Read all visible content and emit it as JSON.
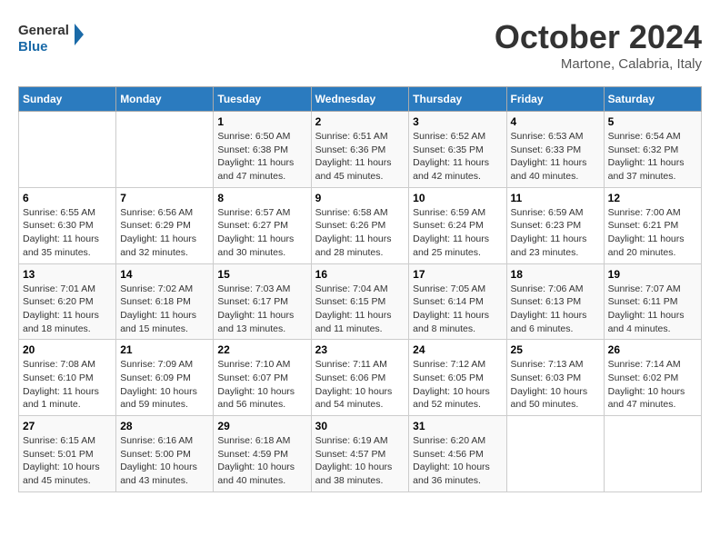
{
  "logo": {
    "line1": "General",
    "line2": "Blue"
  },
  "title": "October 2024",
  "subtitle": "Martone, Calabria, Italy",
  "header": {
    "days": [
      "Sunday",
      "Monday",
      "Tuesday",
      "Wednesday",
      "Thursday",
      "Friday",
      "Saturday"
    ]
  },
  "weeks": [
    [
      {
        "day": "",
        "info": ""
      },
      {
        "day": "",
        "info": ""
      },
      {
        "day": "1",
        "info": "Sunrise: 6:50 AM\nSunset: 6:38 PM\nDaylight: 11 hours and 47 minutes."
      },
      {
        "day": "2",
        "info": "Sunrise: 6:51 AM\nSunset: 6:36 PM\nDaylight: 11 hours and 45 minutes."
      },
      {
        "day": "3",
        "info": "Sunrise: 6:52 AM\nSunset: 6:35 PM\nDaylight: 11 hours and 42 minutes."
      },
      {
        "day": "4",
        "info": "Sunrise: 6:53 AM\nSunset: 6:33 PM\nDaylight: 11 hours and 40 minutes."
      },
      {
        "day": "5",
        "info": "Sunrise: 6:54 AM\nSunset: 6:32 PM\nDaylight: 11 hours and 37 minutes."
      }
    ],
    [
      {
        "day": "6",
        "info": "Sunrise: 6:55 AM\nSunset: 6:30 PM\nDaylight: 11 hours and 35 minutes."
      },
      {
        "day": "7",
        "info": "Sunrise: 6:56 AM\nSunset: 6:29 PM\nDaylight: 11 hours and 32 minutes."
      },
      {
        "day": "8",
        "info": "Sunrise: 6:57 AM\nSunset: 6:27 PM\nDaylight: 11 hours and 30 minutes."
      },
      {
        "day": "9",
        "info": "Sunrise: 6:58 AM\nSunset: 6:26 PM\nDaylight: 11 hours and 28 minutes."
      },
      {
        "day": "10",
        "info": "Sunrise: 6:59 AM\nSunset: 6:24 PM\nDaylight: 11 hours and 25 minutes."
      },
      {
        "day": "11",
        "info": "Sunrise: 6:59 AM\nSunset: 6:23 PM\nDaylight: 11 hours and 23 minutes."
      },
      {
        "day": "12",
        "info": "Sunrise: 7:00 AM\nSunset: 6:21 PM\nDaylight: 11 hours and 20 minutes."
      }
    ],
    [
      {
        "day": "13",
        "info": "Sunrise: 7:01 AM\nSunset: 6:20 PM\nDaylight: 11 hours and 18 minutes."
      },
      {
        "day": "14",
        "info": "Sunrise: 7:02 AM\nSunset: 6:18 PM\nDaylight: 11 hours and 15 minutes."
      },
      {
        "day": "15",
        "info": "Sunrise: 7:03 AM\nSunset: 6:17 PM\nDaylight: 11 hours and 13 minutes."
      },
      {
        "day": "16",
        "info": "Sunrise: 7:04 AM\nSunset: 6:15 PM\nDaylight: 11 hours and 11 minutes."
      },
      {
        "day": "17",
        "info": "Sunrise: 7:05 AM\nSunset: 6:14 PM\nDaylight: 11 hours and 8 minutes."
      },
      {
        "day": "18",
        "info": "Sunrise: 7:06 AM\nSunset: 6:13 PM\nDaylight: 11 hours and 6 minutes."
      },
      {
        "day": "19",
        "info": "Sunrise: 7:07 AM\nSunset: 6:11 PM\nDaylight: 11 hours and 4 minutes."
      }
    ],
    [
      {
        "day": "20",
        "info": "Sunrise: 7:08 AM\nSunset: 6:10 PM\nDaylight: 11 hours and 1 minute."
      },
      {
        "day": "21",
        "info": "Sunrise: 7:09 AM\nSunset: 6:09 PM\nDaylight: 10 hours and 59 minutes."
      },
      {
        "day": "22",
        "info": "Sunrise: 7:10 AM\nSunset: 6:07 PM\nDaylight: 10 hours and 56 minutes."
      },
      {
        "day": "23",
        "info": "Sunrise: 7:11 AM\nSunset: 6:06 PM\nDaylight: 10 hours and 54 minutes."
      },
      {
        "day": "24",
        "info": "Sunrise: 7:12 AM\nSunset: 6:05 PM\nDaylight: 10 hours and 52 minutes."
      },
      {
        "day": "25",
        "info": "Sunrise: 7:13 AM\nSunset: 6:03 PM\nDaylight: 10 hours and 50 minutes."
      },
      {
        "day": "26",
        "info": "Sunrise: 7:14 AM\nSunset: 6:02 PM\nDaylight: 10 hours and 47 minutes."
      }
    ],
    [
      {
        "day": "27",
        "info": "Sunrise: 6:15 AM\nSunset: 5:01 PM\nDaylight: 10 hours and 45 minutes."
      },
      {
        "day": "28",
        "info": "Sunrise: 6:16 AM\nSunset: 5:00 PM\nDaylight: 10 hours and 43 minutes."
      },
      {
        "day": "29",
        "info": "Sunrise: 6:18 AM\nSunset: 4:59 PM\nDaylight: 10 hours and 40 minutes."
      },
      {
        "day": "30",
        "info": "Sunrise: 6:19 AM\nSunset: 4:57 PM\nDaylight: 10 hours and 38 minutes."
      },
      {
        "day": "31",
        "info": "Sunrise: 6:20 AM\nSunset: 4:56 PM\nDaylight: 10 hours and 36 minutes."
      },
      {
        "day": "",
        "info": ""
      },
      {
        "day": "",
        "info": ""
      }
    ]
  ]
}
